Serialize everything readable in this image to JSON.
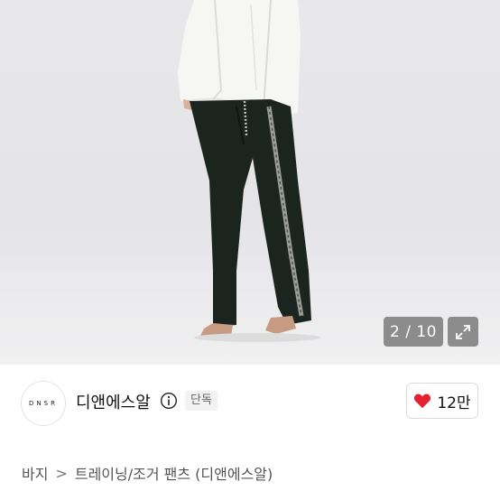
{
  "gallery": {
    "counter": "2 / 10",
    "expand_icon": "expand-arrows-icon"
  },
  "seller": {
    "avatar_text": "DNSR",
    "name": "디앤에스알",
    "info_icon": "info-icon",
    "badge": "단독"
  },
  "like": {
    "icon": "heart-icon",
    "color": "#e5212f",
    "count": "12만"
  },
  "breadcrumb": {
    "category": "바지",
    "separator": ">",
    "product": "트레이닝/조거 팬츠 (디앤에스알)"
  }
}
